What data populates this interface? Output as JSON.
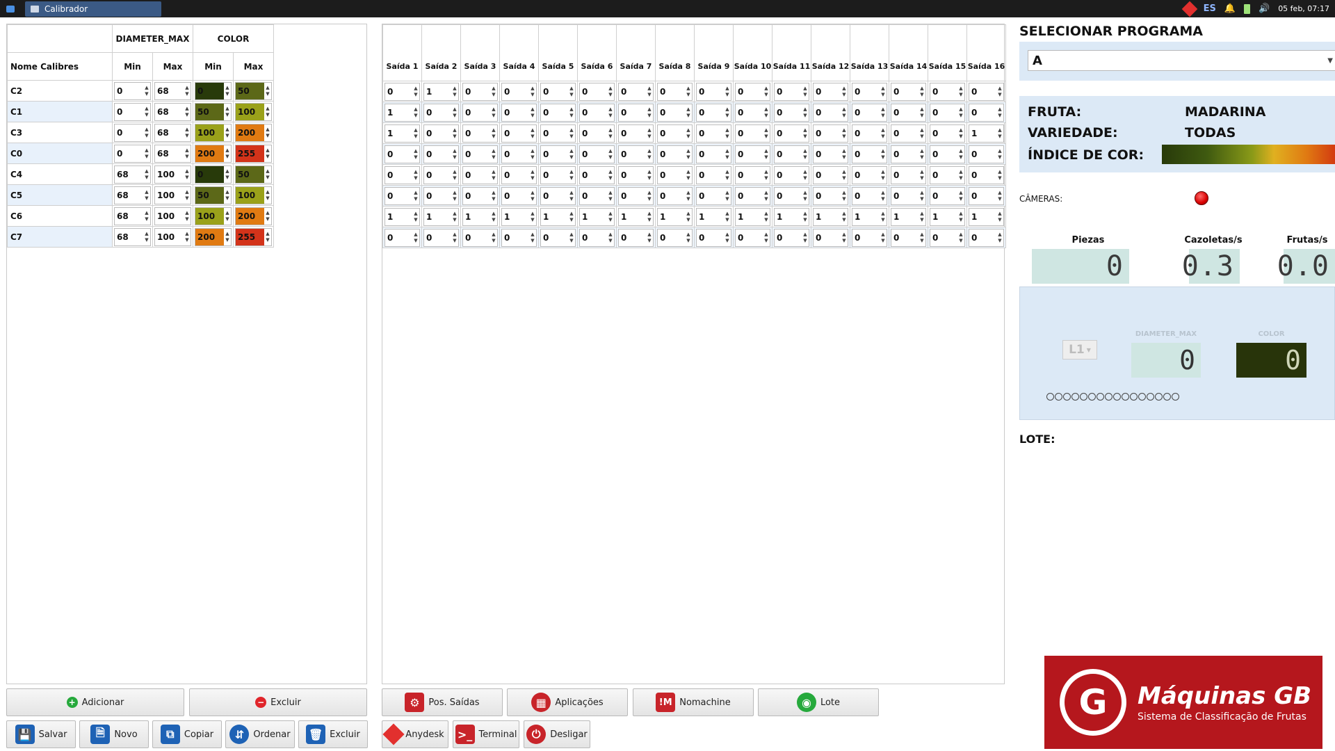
{
  "taskbar": {
    "window_title": "Calibrador",
    "lang": "ES",
    "clock": "05 feb, 07:17"
  },
  "calib": {
    "group_headers": [
      "DIAMETER_MAX",
      "COLOR"
    ],
    "name_header": "Nome Calibres",
    "sub_headers": [
      "Min",
      "Max",
      "Min",
      "Max"
    ],
    "rows": [
      {
        "name": "C2",
        "dmin": "0",
        "dmax": "68",
        "cmin": "0",
        "cmax": "50",
        "cmin_color": "#283a0a",
        "cmax_color": "#5c6818"
      },
      {
        "name": "C1",
        "dmin": "0",
        "dmax": "68",
        "cmin": "50",
        "cmax": "100",
        "cmin_color": "#5c6818",
        "cmax_color": "#9aa11a"
      },
      {
        "name": "C3",
        "dmin": "0",
        "dmax": "68",
        "cmin": "100",
        "cmax": "200",
        "cmin_color": "#9aa11a",
        "cmax_color": "#e07a12"
      },
      {
        "name": "C0",
        "dmin": "0",
        "dmax": "68",
        "cmin": "200",
        "cmax": "255",
        "cmin_color": "#e07a12",
        "cmax_color": "#d3331a"
      },
      {
        "name": "C4",
        "dmin": "68",
        "dmax": "100",
        "cmin": "0",
        "cmax": "50",
        "cmin_color": "#283a0a",
        "cmax_color": "#5c6818"
      },
      {
        "name": "C5",
        "dmin": "68",
        "dmax": "100",
        "cmin": "50",
        "cmax": "100",
        "cmin_color": "#5c6818",
        "cmax_color": "#9aa11a"
      },
      {
        "name": "C6",
        "dmin": "68",
        "dmax": "100",
        "cmin": "100",
        "cmax": "200",
        "cmin_color": "#9aa11a",
        "cmax_color": "#e07a12"
      },
      {
        "name": "C7",
        "dmin": "68",
        "dmax": "100",
        "cmin": "200",
        "cmax": "255",
        "cmin_color": "#e07a12",
        "cmax_color": "#d3331a"
      }
    ]
  },
  "outputs": {
    "headers": [
      "Saída 1",
      "Saída 2",
      "Saída 3",
      "Saída 4",
      "Saída 5",
      "Saída 6",
      "Saída 7",
      "Saída 8",
      "Saída 9",
      "Saída 10",
      "Saída 11",
      "Saída 12",
      "Saída 13",
      "Saída 14",
      "Saída 15",
      "Saída 16"
    ],
    "rows": [
      [
        "0",
        "1",
        "0",
        "0",
        "0",
        "0",
        "0",
        "0",
        "0",
        "0",
        "0",
        "0",
        "0",
        "0",
        "0",
        "0"
      ],
      [
        "1",
        "0",
        "0",
        "0",
        "0",
        "0",
        "0",
        "0",
        "0",
        "0",
        "0",
        "0",
        "0",
        "0",
        "0",
        "0"
      ],
      [
        "1",
        "0",
        "0",
        "0",
        "0",
        "0",
        "0",
        "0",
        "0",
        "0",
        "0",
        "0",
        "0",
        "0",
        "0",
        "1"
      ],
      [
        "0",
        "0",
        "0",
        "0",
        "0",
        "0",
        "0",
        "0",
        "0",
        "0",
        "0",
        "0",
        "0",
        "0",
        "0",
        "0"
      ],
      [
        "0",
        "0",
        "0",
        "0",
        "0",
        "0",
        "0",
        "0",
        "0",
        "0",
        "0",
        "0",
        "0",
        "0",
        "0",
        "0"
      ],
      [
        "0",
        "0",
        "0",
        "0",
        "0",
        "0",
        "0",
        "0",
        "0",
        "0",
        "0",
        "0",
        "0",
        "0",
        "0",
        "0"
      ],
      [
        "1",
        "1",
        "1",
        "1",
        "1",
        "1",
        "1",
        "1",
        "1",
        "1",
        "1",
        "1",
        "1",
        "1",
        "1",
        "1"
      ],
      [
        "0",
        "0",
        "0",
        "0",
        "0",
        "0",
        "0",
        "0",
        "0",
        "0",
        "0",
        "0",
        "0",
        "0",
        "0",
        "0"
      ]
    ]
  },
  "program": {
    "title": "SELECIONAR PROGRAMA",
    "selected": "A"
  },
  "fruit": {
    "fruta_label": "FRUTA:",
    "fruta_value": "MADARINA",
    "variedade_label": "VARIEDADE:",
    "variedade_value": "TODAS",
    "indice_label": "ÍNDICE DE COR:"
  },
  "cameras": {
    "label": "CÂMERAS:",
    "status_color": "#d80000"
  },
  "stats": {
    "pieces_label": "Piezas",
    "pieces_value": "0",
    "cups_label": "Cazoletas/s",
    "cups_value": "0.3",
    "fruits_label": "Frutas/s",
    "fruits_value": "0.0"
  },
  "live": {
    "line": "L1",
    "dia_label": "DIAMETER_MAX",
    "dia_value": "0",
    "color_label": "COLOR",
    "color_value": "0"
  },
  "lote": {
    "label": "LOTE:"
  },
  "logo": {
    "name": "Máquinas GB",
    "tagline": "Sistema de Classificação de Frutas",
    "mark": "G"
  },
  "buttons": {
    "adicionar": "Adicionar",
    "excluir_top": "Excluir",
    "salvar": "Salvar",
    "novo": "Novo",
    "copiar": "Copiar",
    "ordenar": "Ordenar",
    "excluir_bottom": "Excluir",
    "pos_saidas": "Pos. Saídas",
    "aplicacoes": "Aplicações",
    "nomachine": "Nomachine",
    "lote": "Lote",
    "anydesk": "Anydesk",
    "terminal": "Terminal",
    "desligar": "Desligar"
  }
}
